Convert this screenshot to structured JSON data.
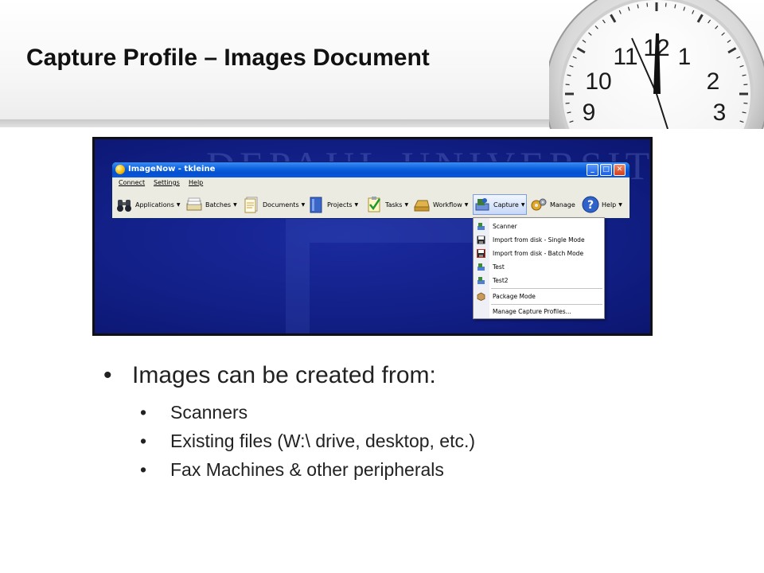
{
  "slide": {
    "title": "Capture Profile – Images Document"
  },
  "clock": {
    "numerals": [
      "12",
      "1",
      "2",
      "3",
      "9",
      "10",
      "11"
    ]
  },
  "watermark": {
    "text": "DEPAUL UNIVERSITY"
  },
  "window": {
    "title": "ImageNow - tkleine",
    "controls": {
      "minimize": "_",
      "maximize": "□",
      "close": "✕"
    },
    "menu": [
      "Connect",
      "Settings",
      "Help"
    ],
    "toolbar": [
      {
        "label": "Applications",
        "icon": "binoculars-icon"
      },
      {
        "label": "Batches",
        "icon": "batches-icon"
      },
      {
        "label": "Documents",
        "icon": "documents-icon"
      },
      {
        "label": "Projects",
        "icon": "projects-icon"
      },
      {
        "label": "Tasks",
        "icon": "tasks-icon"
      },
      {
        "label": "Workflow",
        "icon": "workflow-icon"
      },
      {
        "label": "Capture",
        "icon": "capture-icon",
        "active": true
      },
      {
        "label": "Manage",
        "icon": "gears-icon"
      },
      {
        "label": "Help",
        "icon": "help-icon"
      }
    ],
    "dropdown_arrow": "▼",
    "capture_menu": [
      {
        "label": "Scanner",
        "icon": "scanner-icon"
      },
      {
        "label": "Import from disk - Single Mode",
        "icon": "floppy-icon"
      },
      {
        "label": "Import from disk - Batch Mode",
        "icon": "floppy-batch-icon"
      },
      {
        "label": "Test",
        "icon": "scanner-icon"
      },
      {
        "label": "Test2",
        "icon": "scanner-icon"
      },
      {
        "label": "Package Mode",
        "icon": "package-icon"
      },
      {
        "label": "Manage Capture Profiles...",
        "icon": ""
      }
    ]
  },
  "bullets": {
    "marker": "•",
    "main": "Images can be created from:",
    "sub": [
      "Scanners",
      "Existing files (W:\\ drive, desktop, etc.)",
      "Fax Machines & other peripherals"
    ]
  },
  "colors": {
    "title_text": "#111111",
    "body_text": "#222222",
    "screenshot_background": "#122088",
    "titlebar_blue": "#0a5fdc",
    "window_face": "#ecebe1"
  }
}
